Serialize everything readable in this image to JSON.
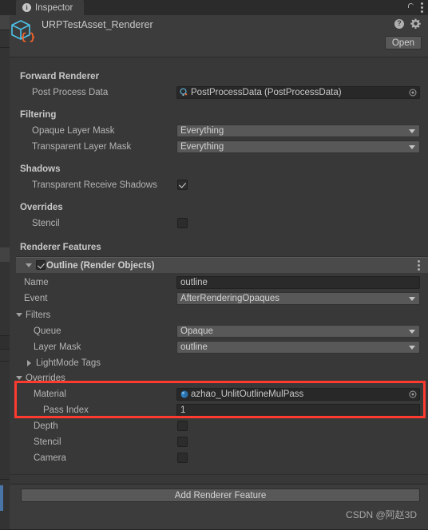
{
  "window": {
    "tab_label": "Inspector",
    "tab_icon": "info-circle-icon",
    "lock_icon": "unlocked-padlock-icon",
    "menu_icon": "kebab-menu-icon"
  },
  "header": {
    "asset_name": "URPTestAsset_Renderer",
    "asset_icon": "scriptable-object-cube-icon",
    "help_icon": "help-circle-icon",
    "settings_icon": "gear-icon",
    "open_button": "Open"
  },
  "sections": {
    "forward_renderer": {
      "title": "Forward Renderer",
      "post_process_data": {
        "label": "Post Process Data",
        "value": "PostProcessData (PostProcessData)",
        "icon": "postprocess-asset-icon",
        "picker_icon": "object-picker-icon"
      }
    },
    "filtering": {
      "title": "Filtering",
      "opaque_layer_mask": {
        "label": "Opaque Layer Mask",
        "value": "Everything"
      },
      "transparent_layer_mask": {
        "label": "Transparent Layer Mask",
        "value": "Everything"
      }
    },
    "shadows": {
      "title": "Shadows",
      "transparent_receive_shadows": {
        "label": "Transparent Receive Shadows",
        "checked": true
      }
    },
    "overrides": {
      "title": "Overrides",
      "stencil": {
        "label": "Stencil",
        "checked": false
      }
    },
    "renderer_features": {
      "title": "Renderer Features"
    }
  },
  "feature": {
    "title": "Outline (Render Objects)",
    "enabled": true,
    "menu_icon": "kebab-menu-icon",
    "name": {
      "label": "Name",
      "value": "outline"
    },
    "event": {
      "label": "Event",
      "value": "AfterRenderingOpaques"
    },
    "filters": {
      "label": "Filters",
      "expanded": true,
      "queue": {
        "label": "Queue",
        "value": "Opaque"
      },
      "layer_mask": {
        "label": "Layer Mask",
        "value": "outline"
      },
      "lightmode_tags": {
        "label": "LightMode Tags",
        "expanded": false
      }
    },
    "overrides": {
      "label": "Overrides",
      "expanded": true,
      "material": {
        "label": "Material",
        "value": "azhao_UnlitOutlineMulPass",
        "icon": "material-sphere-icon",
        "picker_icon": "object-picker-icon"
      },
      "pass_index": {
        "label": "Pass Index",
        "value": "1"
      },
      "depth": {
        "label": "Depth",
        "checked": false
      },
      "stencil": {
        "label": "Stencil",
        "checked": false
      },
      "camera": {
        "label": "Camera",
        "checked": false
      }
    }
  },
  "footer": {
    "add_renderer_feature": "Add Renderer Feature",
    "watermark": "CSDN @阿赵3D"
  },
  "colors": {
    "background": "#383838",
    "panel": "#3c3c3c",
    "dropdown": "#585858",
    "field": "#282828",
    "text": "#b4b4b4",
    "accent": "#4874a8",
    "annotation": "#ff3b30"
  }
}
